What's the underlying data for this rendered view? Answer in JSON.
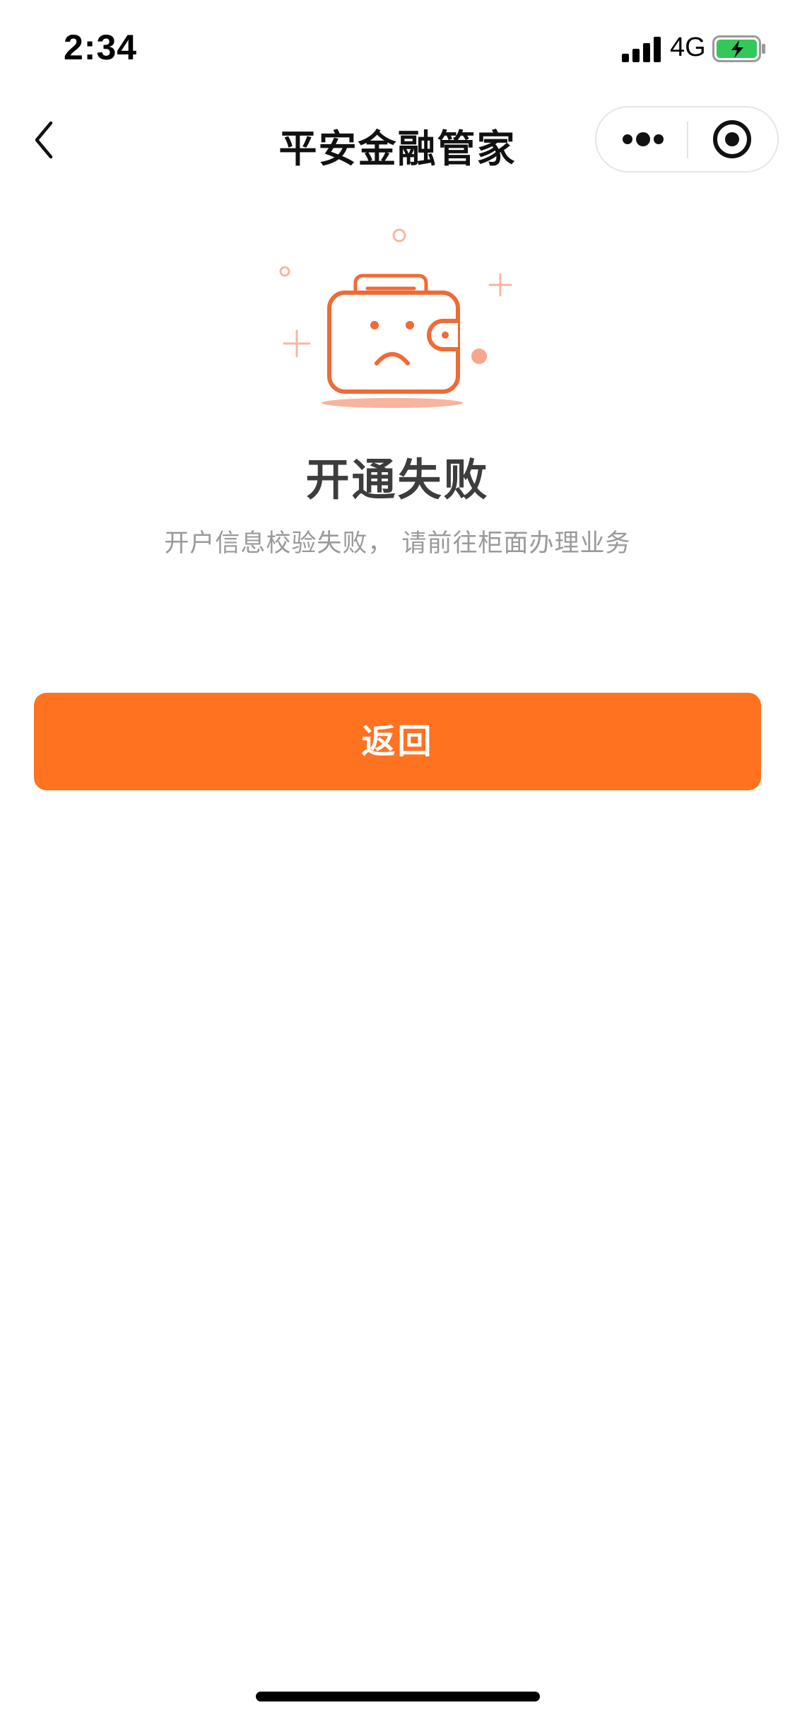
{
  "status_bar": {
    "time": "2:34",
    "network": "4G",
    "icons": [
      "signal-icon",
      "battery-charging-icon"
    ]
  },
  "nav": {
    "title": "平安金融管家",
    "icons": [
      "back-chevron-icon",
      "more-dots-icon",
      "close-target-icon"
    ]
  },
  "result": {
    "illustration": "sad-wallet-icon",
    "title": "开通失败",
    "description": "开户信息校验失败， 请前往柜面办理业务"
  },
  "actions": {
    "return_label": "返回"
  },
  "colors": {
    "accent": "#ff7220",
    "illustration": "#f06a35",
    "battery_charge": "#34c759",
    "title_text": "#3d3d3d",
    "desc_text": "#9a9a9a"
  }
}
